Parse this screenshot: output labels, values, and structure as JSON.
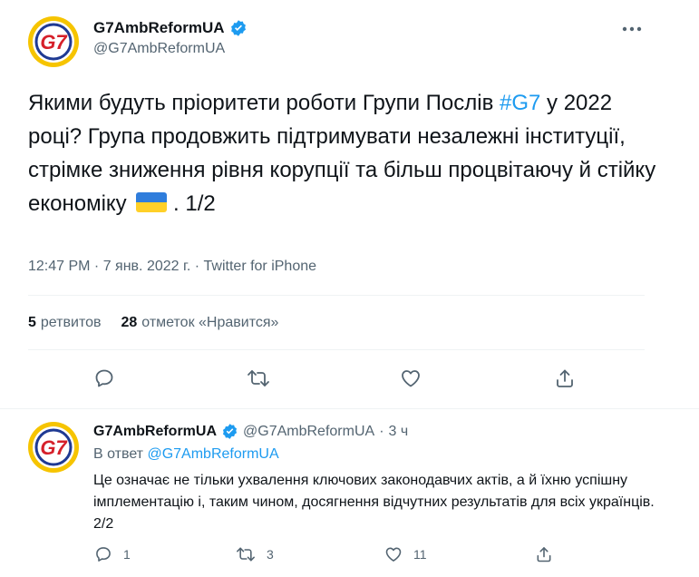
{
  "main_tweet": {
    "display_name": "G7AmbReformUA",
    "handle": "@G7AmbReformUA",
    "text_part1": "Якими будуть пріоритети роботи Групи Послів ",
    "hashtag": "#G7",
    "text_part2": " у 2022 році? Група продовжить підтримувати незалежні інституції, стрімке зниження рівня корупції та більш процвітаючу й стійку економіку ",
    "text_part3": " . 1/2",
    "timestamp": "12:47 PM · 7 янв. 2022 г. · Twitter for iPhone",
    "retweets_count": "5",
    "retweets_label": "ретвитов",
    "likes_count": "28",
    "likes_label": "отметок «Нравится»"
  },
  "reply_tweet": {
    "display_name": "G7AmbReformUA",
    "handle": "@G7AmbReformUA",
    "dot": "·",
    "time": "3 ч",
    "in_reply_prefix": "В ответ ",
    "in_reply_handle": "@G7AmbReformUA",
    "text": "Це означає не тільки ухвалення ключових законодавчих актів, а й їхню успішну імплементацію і, таким чином, досягнення відчутних результатів для всіх українців. 2/2",
    "reply_count": "1",
    "retweet_count": "3",
    "like_count": "11"
  },
  "avatar_logo_text": "G7",
  "icons": {
    "verified": "verified-badge-icon",
    "more": "more-icon",
    "reply": "reply-icon",
    "retweet": "retweet-icon",
    "like": "like-icon",
    "share": "share-icon"
  },
  "colors": {
    "accent": "#1d9bf0",
    "secondary_text": "#536471",
    "primary_text": "#0f1419",
    "logo_blue": "#1f3a93",
    "logo_red": "#d6202a",
    "logo_yellow": "#f6c400",
    "flag_blue": "#2f7ddc",
    "flag_yellow": "#ffd028"
  }
}
